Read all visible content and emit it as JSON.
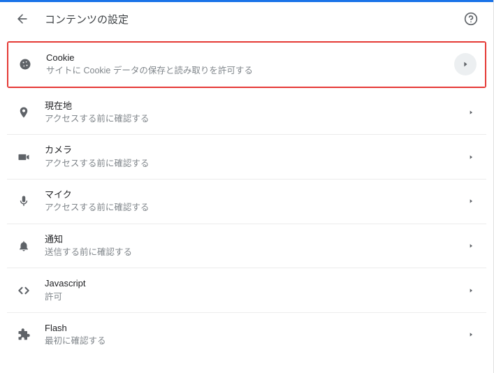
{
  "accentColor": "#1a73e8",
  "header": {
    "title": "コンテンツの設定"
  },
  "items": [
    {
      "icon": "cookie-icon",
      "title": "Cookie",
      "subtitle": "サイトに Cookie データの保存と読み取りを許可する",
      "highlight": true,
      "chevStyle": "circle"
    },
    {
      "icon": "location-icon",
      "title": "現在地",
      "subtitle": "アクセスする前に確認する",
      "highlight": false,
      "chevStyle": "plain"
    },
    {
      "icon": "camera-icon",
      "title": "カメラ",
      "subtitle": "アクセスする前に確認する",
      "highlight": false,
      "chevStyle": "plain"
    },
    {
      "icon": "mic-icon",
      "title": "マイク",
      "subtitle": "アクセスする前に確認する",
      "highlight": false,
      "chevStyle": "plain"
    },
    {
      "icon": "bell-icon",
      "title": "通知",
      "subtitle": "送信する前に確認する",
      "highlight": false,
      "chevStyle": "plain"
    },
    {
      "icon": "code-icon",
      "title": "Javascript",
      "subtitle": "許可",
      "highlight": false,
      "chevStyle": "plain"
    },
    {
      "icon": "plugin-icon",
      "title": "Flash",
      "subtitle": "最初に確認する",
      "highlight": false,
      "chevStyle": "plain"
    }
  ]
}
